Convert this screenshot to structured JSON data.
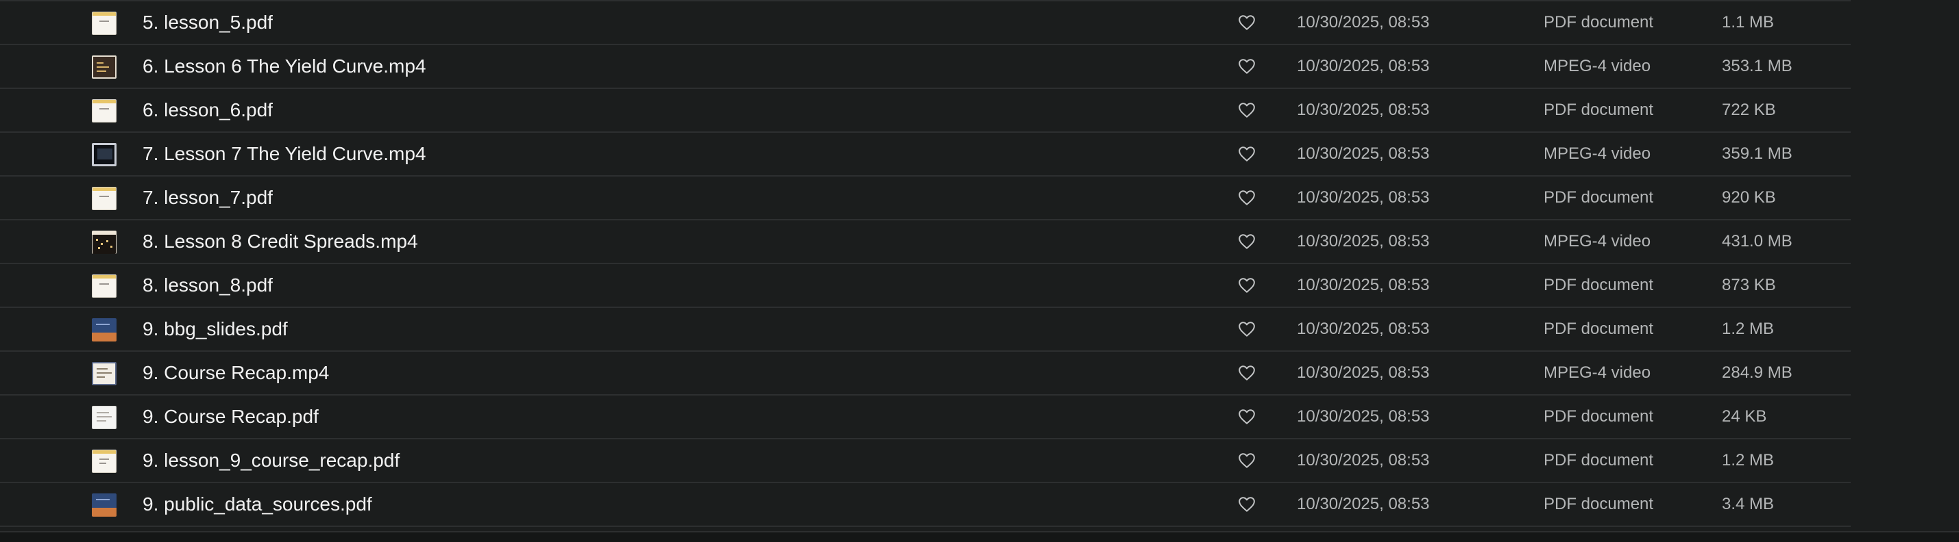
{
  "files": [
    {
      "name": "5. lesson_5.pdf",
      "date": "10/30/2025, 08:53",
      "kind": "PDF document",
      "size": "1.1 MB",
      "thumb": "pdf-lesson"
    },
    {
      "name": "6. Lesson 6 The Yield Curve.mp4",
      "date": "10/30/2025, 08:53",
      "kind": "MPEG-4 video",
      "size": "353.1 MB",
      "thumb": "video-a"
    },
    {
      "name": "6. lesson_6.pdf",
      "date": "10/30/2025, 08:53",
      "kind": "PDF document",
      "size": "722 KB",
      "thumb": "pdf-lesson"
    },
    {
      "name": "7. Lesson 7 The Yield Curve.mp4",
      "date": "10/30/2025, 08:53",
      "kind": "MPEG-4 video",
      "size": "359.1 MB",
      "thumb": "video-b"
    },
    {
      "name": "7. lesson_7.pdf",
      "date": "10/30/2025, 08:53",
      "kind": "PDF document",
      "size": "920 KB",
      "thumb": "pdf-lesson"
    },
    {
      "name": "8. Lesson 8 Credit Spreads.mp4",
      "date": "10/30/2025, 08:53",
      "kind": "MPEG-4 video",
      "size": "431.0 MB",
      "thumb": "video-c"
    },
    {
      "name": "8. lesson_8.pdf",
      "date": "10/30/2025, 08:53",
      "kind": "PDF document",
      "size": "873 KB",
      "thumb": "pdf-lesson"
    },
    {
      "name": "9. bbg_slides.pdf",
      "date": "10/30/2025, 08:53",
      "kind": "PDF document",
      "size": "1.2 MB",
      "thumb": "pdf-blue"
    },
    {
      "name": "9. Course Recap.mp4",
      "date": "10/30/2025, 08:53",
      "kind": "MPEG-4 video",
      "size": "284.9 MB",
      "thumb": "video-d"
    },
    {
      "name": "9. Course Recap.pdf",
      "date": "10/30/2025, 08:53",
      "kind": "PDF document",
      "size": "24 KB",
      "thumb": "pdf-plain"
    },
    {
      "name": "9. lesson_9_course_recap.pdf",
      "date": "10/30/2025, 08:53",
      "kind": "PDF document",
      "size": "1.2 MB",
      "thumb": "pdf-lesson"
    },
    {
      "name": "9. public_data_sources.pdf",
      "date": "10/30/2025, 08:53",
      "kind": "PDF document",
      "size": "3.4 MB",
      "thumb": "pdf-blue"
    }
  ],
  "favorite_icon": "heart-outline-icon",
  "colors": {
    "background": "#1b1d1d",
    "divider": "#2d2f30",
    "name_text": "#f2f2f2",
    "meta_text": "#b4b6b7"
  }
}
